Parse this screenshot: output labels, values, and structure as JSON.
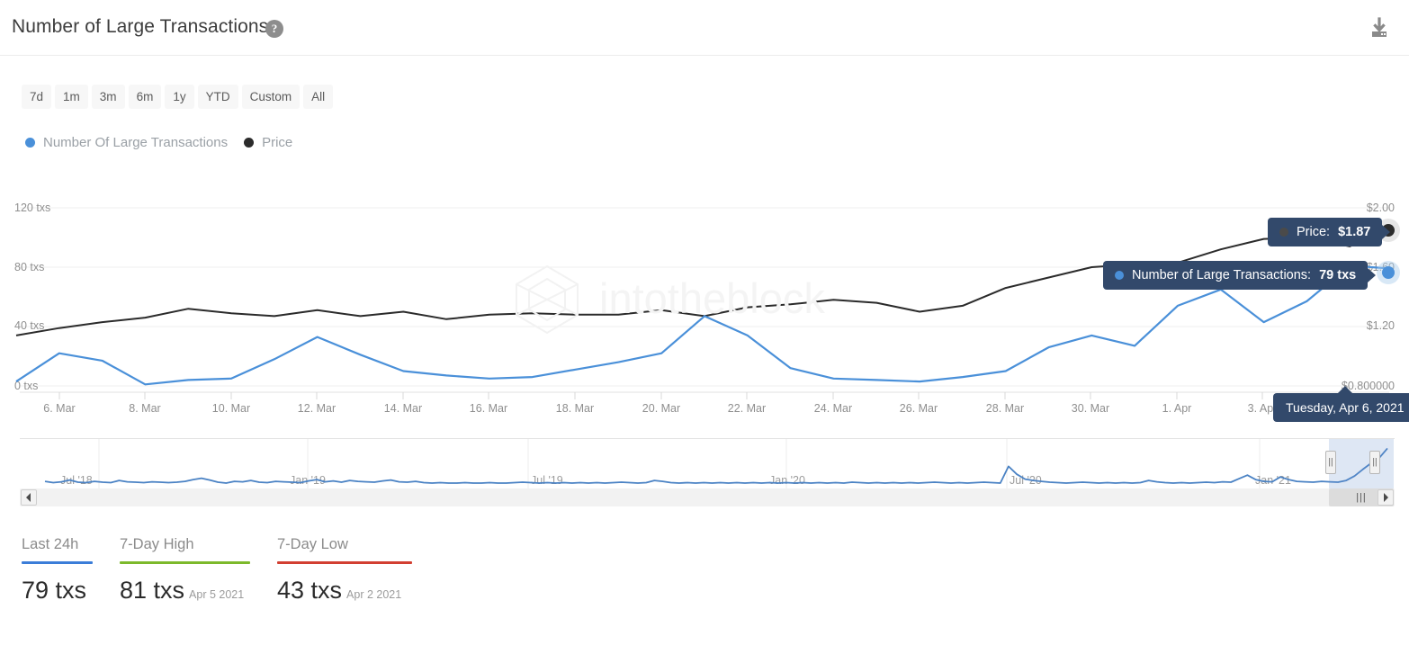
{
  "header": {
    "title": "Number of Large Transactions",
    "help_icon": "question-mark-icon",
    "download_icon": "download-icon"
  },
  "ranges": {
    "buttons": [
      "7d",
      "1m",
      "3m",
      "6m",
      "1y",
      "YTD",
      "Custom",
      "All"
    ]
  },
  "legend": {
    "items": [
      {
        "label": "Number Of Large Transactions",
        "color": "#4a90d9"
      },
      {
        "label": "Price",
        "color": "#2b2b2b"
      }
    ]
  },
  "watermark": {
    "text": "intotheblock"
  },
  "tooltips": {
    "price": {
      "prefix": "Price:",
      "value": "$1.87",
      "dot_color": "#2b2b2b"
    },
    "transactions": {
      "prefix": "Number of Large Transactions:",
      "value": "79 txs",
      "dot_color": "#4a90d9"
    },
    "date": {
      "text": "Tuesday, Apr 6, 2021"
    }
  },
  "chart_data": {
    "type": "line",
    "title": "Number of Large Transactions",
    "xlabel": "",
    "ylabel": "txs",
    "y_left_ticks": [
      "0 txs",
      "40 txs",
      "80 txs",
      "120 txs"
    ],
    "y_left_values": [
      0,
      40,
      80,
      120
    ],
    "y_left_lim": [
      0,
      132
    ],
    "y_right_ticks": [
      "$0.800000",
      "$1.20",
      "$1.60",
      "$2.00"
    ],
    "y_right_values": [
      0.8,
      1.2,
      1.6,
      2.0
    ],
    "y_right_lim": [
      0.66,
      2.06
    ],
    "x_ticks": [
      "6. Mar",
      "8. Mar",
      "10. Mar",
      "12. Mar",
      "14. Mar",
      "16. Mar",
      "18. Mar",
      "20. Mar",
      "22. Mar",
      "24. Mar",
      "26. Mar",
      "28. Mar",
      "30. Mar",
      "1. Apr",
      "3. Apr"
    ],
    "grid": true,
    "legend_position": "top-left",
    "x": [
      "5. Mar",
      "6. Mar",
      "7. Mar",
      "8. Mar",
      "9. Mar",
      "10. Mar",
      "11. Mar",
      "12. Mar",
      "13. Mar",
      "14. Mar",
      "15. Mar",
      "16. Mar",
      "17. Mar",
      "18. Mar",
      "19. Mar",
      "20. Mar",
      "21. Mar",
      "22. Mar",
      "23. Mar",
      "24. Mar",
      "25. Mar",
      "26. Mar",
      "27. Mar",
      "28. Mar",
      "29. Mar",
      "30. Mar",
      "31. Mar",
      "1. Apr",
      "2. Apr",
      "3. Apr",
      "4. Apr",
      "5. Apr",
      "6. Apr"
    ],
    "series": [
      {
        "name": "Number Of Large Transactions",
        "color": "#4a90d9",
        "axis": "left",
        "unit": "txs",
        "values": [
          3,
          22,
          17,
          1,
          4,
          5,
          18,
          33,
          21,
          10,
          7,
          5,
          6,
          11,
          16,
          22,
          47,
          34,
          12,
          5,
          4,
          3,
          6,
          10,
          26,
          34,
          27,
          54,
          65,
          43,
          57,
          81,
          79
        ]
      },
      {
        "name": "Price",
        "color": "#2b2b2b",
        "axis": "right",
        "unit": "$",
        "values": [
          1.14,
          1.19,
          1.23,
          1.26,
          1.32,
          1.29,
          1.27,
          1.31,
          1.27,
          1.3,
          1.25,
          1.28,
          1.29,
          1.28,
          1.28,
          1.31,
          1.27,
          1.33,
          1.35,
          1.38,
          1.36,
          1.3,
          1.34,
          1.46,
          1.53,
          1.6,
          1.62,
          1.63,
          1.72,
          1.79,
          1.8,
          1.74,
          1.87
        ]
      }
    ],
    "hover_point": {
      "date": "Tuesday, Apr 6, 2021",
      "transactions": 79,
      "price": 1.87
    }
  },
  "navigator": {
    "ticks": [
      "Jul '18",
      "Jan '19",
      "Jul '19",
      "Jan '20",
      "Jul '20",
      "Jan '21"
    ],
    "left_arrow": "scroll-left-arrow-icon",
    "right_arrow": "scroll-right-arrow-icon",
    "thumb_grip": "|||",
    "handle_grip": "||"
  },
  "stats": [
    {
      "label": "Last 24h",
      "value": "79 txs",
      "date": "",
      "color": "#3b7dd8"
    },
    {
      "label": "7-Day High",
      "value": "81 txs",
      "date": "Apr 5 2021",
      "color": "#7cb92b"
    },
    {
      "label": "7-Day Low",
      "value": "43 txs",
      "date": "Apr 2 2021",
      "color": "#d23f31"
    }
  ]
}
